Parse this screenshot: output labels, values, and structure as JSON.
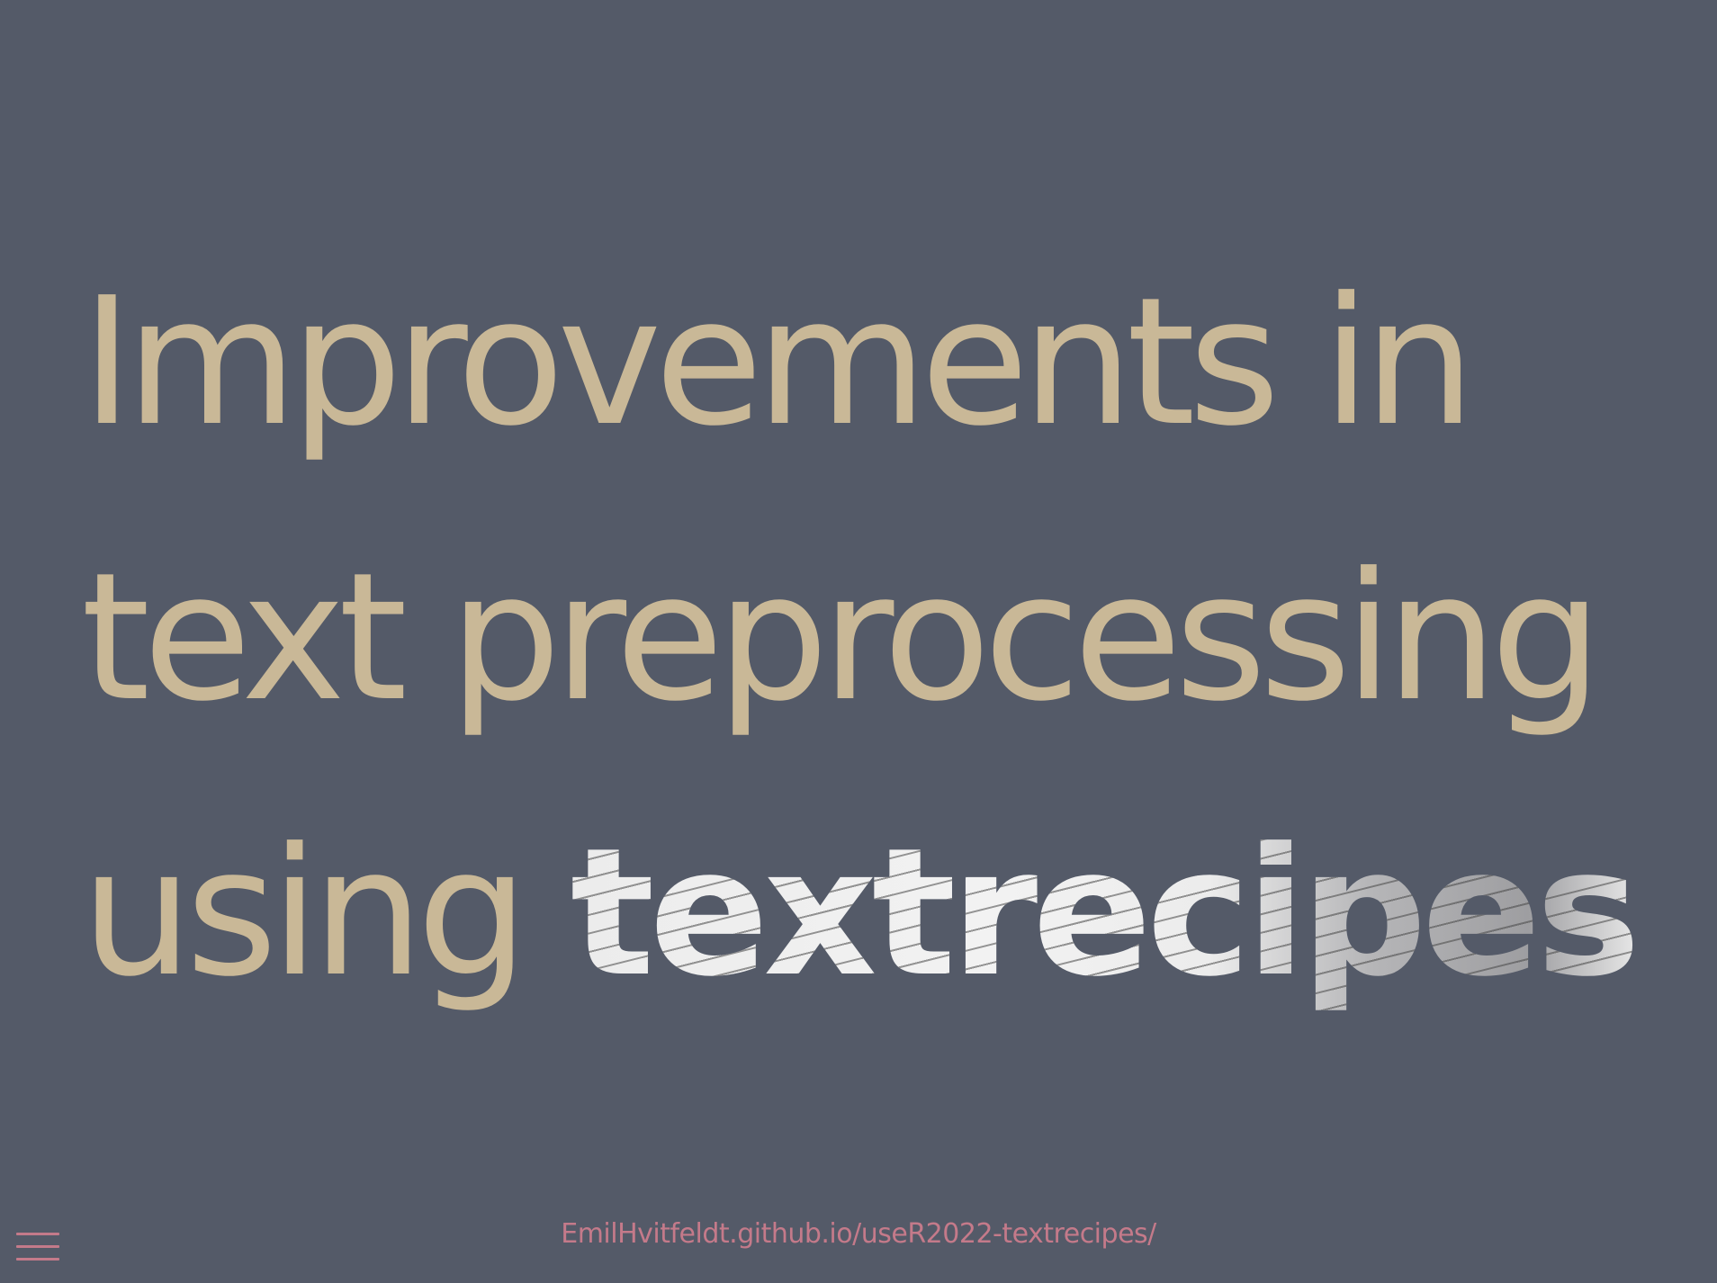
{
  "slide": {
    "title_line1": "Improvements in",
    "title_line2": "text preprocessing",
    "title_line3_prefix": "using ",
    "title_package": "textrecipes",
    "footer_url": "EmilHvitfeldt.github.io/useR2022-textrecipes/"
  },
  "menu": {
    "icon": "hamburger-menu-icon"
  },
  "colors": {
    "background": "#545a68",
    "title": "#c9b897",
    "accent": "#c47a8a"
  }
}
